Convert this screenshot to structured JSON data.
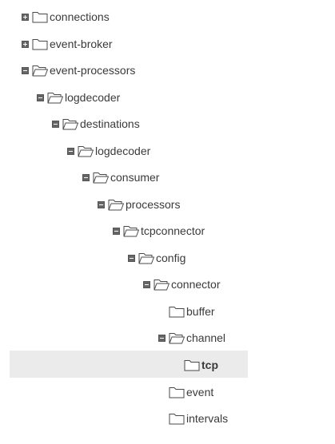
{
  "tree": {
    "nodes": [
      {
        "label": "connections",
        "state": "collapsed",
        "depth": 0
      },
      {
        "label": "event-broker",
        "state": "collapsed",
        "depth": 0
      },
      {
        "label": "event-processors",
        "state": "expanded",
        "depth": 0
      },
      {
        "label": "logdecoder",
        "state": "expanded",
        "depth": 1
      },
      {
        "label": "destinations",
        "state": "expanded",
        "depth": 2
      },
      {
        "label": "logdecoder",
        "state": "expanded",
        "depth": 3
      },
      {
        "label": "consumer",
        "state": "expanded",
        "depth": 4
      },
      {
        "label": "processors",
        "state": "expanded",
        "depth": 5
      },
      {
        "label": "tcpconnector",
        "state": "expanded",
        "depth": 6
      },
      {
        "label": "config",
        "state": "expanded",
        "depth": 7
      },
      {
        "label": "connector",
        "state": "expanded",
        "depth": 8
      },
      {
        "label": "buffer",
        "state": "leaf",
        "depth": 9
      },
      {
        "label": "channel",
        "state": "expanded",
        "depth": 9
      },
      {
        "label": "tcp",
        "state": "leaf",
        "depth": 10,
        "selected": true
      },
      {
        "label": "event",
        "state": "leaf",
        "depth": 9
      },
      {
        "label": "intervals",
        "state": "leaf",
        "depth": 9
      }
    ],
    "colors": {
      "selection": "#ebebeb",
      "toggle": "#666666",
      "folder_stroke": "#4a4a4a",
      "text": "#3a3a3a"
    },
    "icons": {
      "open": "folder-open-icon",
      "closed": "folder-icon"
    }
  }
}
